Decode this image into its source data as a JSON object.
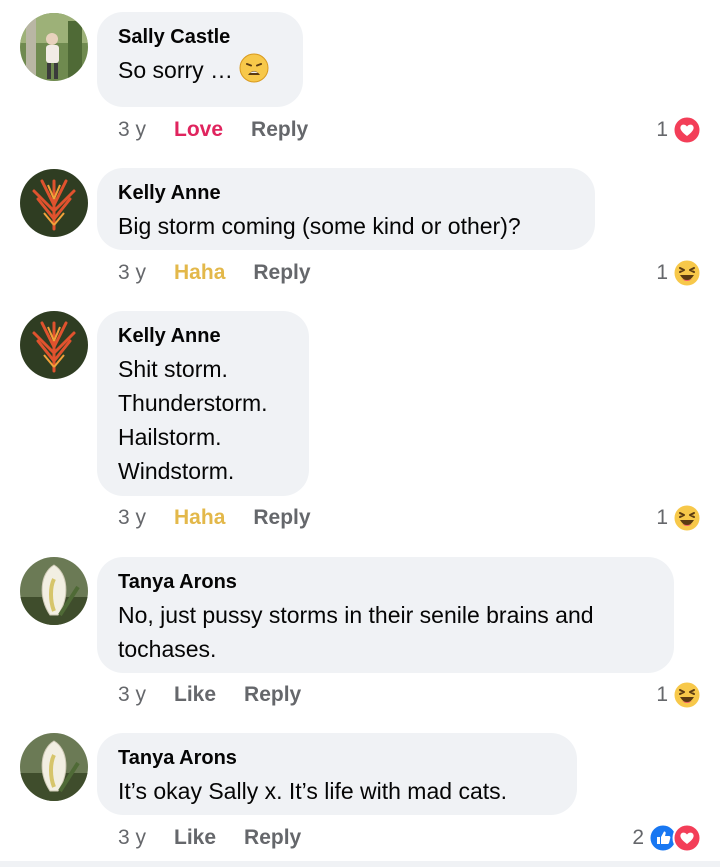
{
  "comments": [
    {
      "author": "Sally Castle",
      "text": "So sorry …",
      "time": "3 y",
      "reaction_action": "Love",
      "reply_label": "Reply",
      "reaction_count": "1",
      "reaction_icons": [
        "love-icon"
      ],
      "inline_emoji": "weary-face-emoji"
    },
    {
      "author": "Kelly Anne",
      "text": "Big storm coming (some kind or other)?",
      "time": "3 y",
      "reaction_action": "Haha",
      "reply_label": "Reply",
      "reaction_count": "1",
      "reaction_icons": [
        "haha-icon"
      ]
    },
    {
      "author": "Kelly Anne",
      "text": "Shit storm.\nThunderstorm.\nHailstorm.\nWindstorm.",
      "time": "3 y",
      "reaction_action": "Haha",
      "reply_label": "Reply",
      "reaction_count": "1",
      "reaction_icons": [
        "haha-icon"
      ]
    },
    {
      "author": "Tanya Arons",
      "text": "No, just pussy storms in their senile brains and\ntochases.",
      "time": "3 y",
      "reaction_action": "Like",
      "reply_label": "Reply",
      "reaction_count": "1",
      "reaction_icons": [
        "haha-icon"
      ]
    },
    {
      "author": "Tanya Arons",
      "text": "It’s okay Sally x. It’s life with mad cats.",
      "time": "3 y",
      "reaction_action": "Like",
      "reply_label": "Reply",
      "reaction_count": "2",
      "reaction_icons": [
        "like-icon",
        "love-icon"
      ]
    }
  ],
  "colors": {
    "bubble": "#f0f2f5",
    "secondary_text": "#65676b",
    "love": "#e0245e",
    "haha": "#e3b84a",
    "like_blue": "#1877f2"
  }
}
